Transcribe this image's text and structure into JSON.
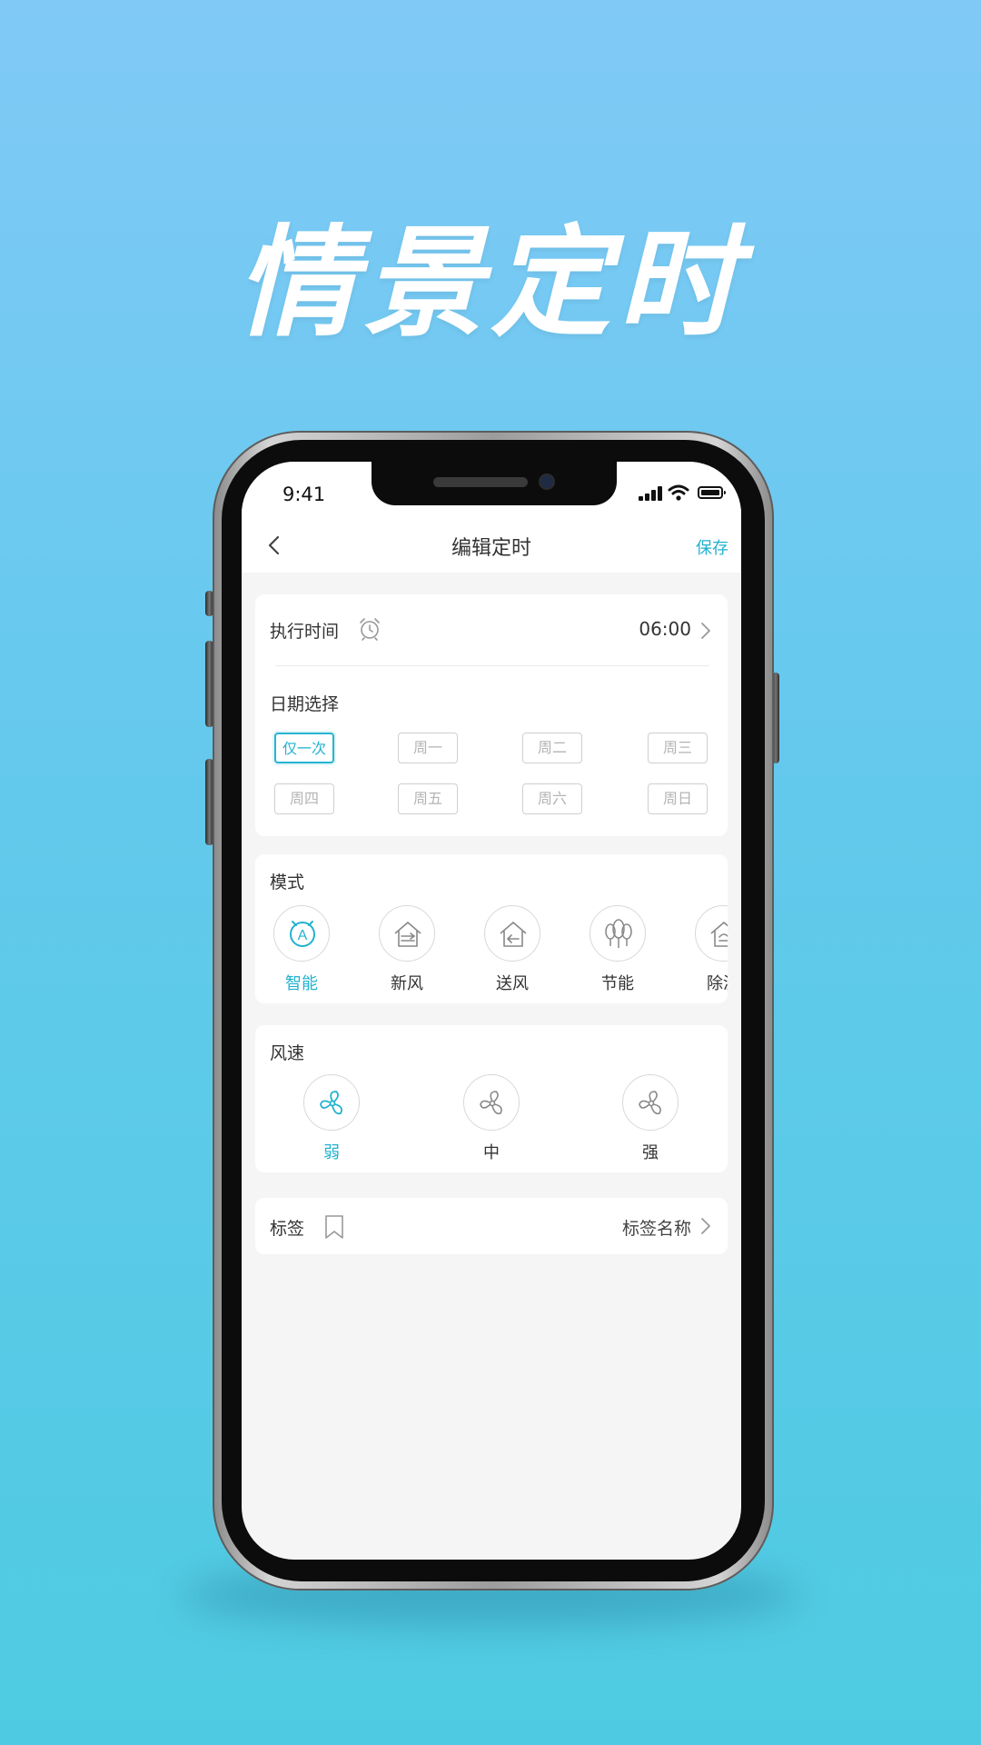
{
  "hero": {
    "title": "情景定时"
  },
  "status": {
    "time": "9:41"
  },
  "nav": {
    "title": "编辑定时",
    "save_label": "保存"
  },
  "execution": {
    "label": "执行时间",
    "value": "06:00"
  },
  "dates": {
    "label": "日期选择",
    "options": [
      "仅一次",
      "周一",
      "周二",
      "周三",
      "周四",
      "周五",
      "周六",
      "周日"
    ],
    "selected": "仅一次"
  },
  "mode": {
    "label": "模式",
    "items": [
      {
        "label": "智能",
        "icon": "auto-mode-icon"
      },
      {
        "label": "新风",
        "icon": "fresh-air-icon"
      },
      {
        "label": "送风",
        "icon": "air-supply-icon"
      },
      {
        "label": "节能",
        "icon": "energy-saving-icon"
      },
      {
        "label": "除湿",
        "icon": "dehumidify-icon"
      }
    ],
    "selected": "智能"
  },
  "fan_speed": {
    "label": "风速",
    "items": [
      {
        "label": "弱",
        "icon": "fan-icon"
      },
      {
        "label": "中",
        "icon": "fan-icon"
      },
      {
        "label": "强",
        "icon": "fan-icon"
      }
    ],
    "selected": "弱"
  },
  "tag": {
    "label": "标签",
    "value": "标签名称"
  },
  "colors": {
    "accent": "#22b2cf",
    "inactive": "#b4b4b4",
    "text": "#333333"
  }
}
